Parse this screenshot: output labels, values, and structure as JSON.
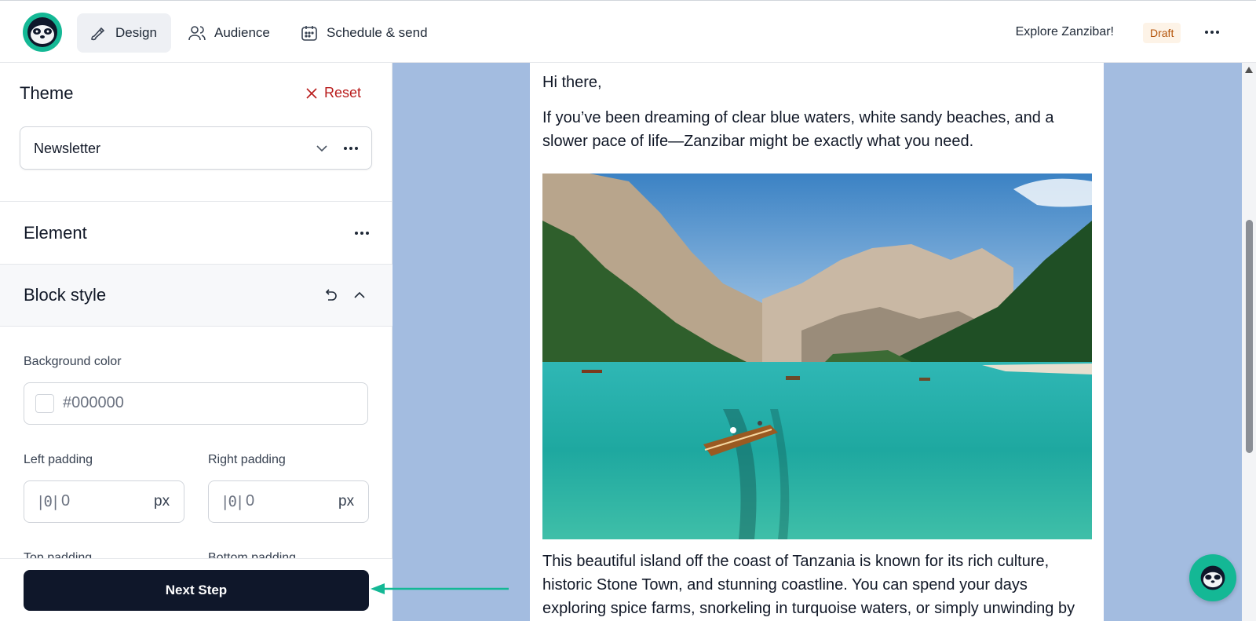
{
  "header": {
    "nav": [
      {
        "label": "Design",
        "icon": "brush-icon",
        "active": true
      },
      {
        "label": "Audience",
        "icon": "users-icon",
        "active": false
      },
      {
        "label": "Schedule & send",
        "icon": "calendar-icon",
        "active": false
      }
    ],
    "campaign_name": "Explore Zanzibar!",
    "status_badge": "Draft"
  },
  "theme": {
    "title": "Theme",
    "reset_label": "Reset",
    "selected": "Newsletter"
  },
  "element": {
    "title": "Element"
  },
  "block_style": {
    "title": "Block style",
    "background_color_label": "Background color",
    "background_color_value": "#000000",
    "left_padding_label": "Left padding",
    "left_padding_value": "0",
    "right_padding_label": "Right padding",
    "right_padding_value": "0",
    "unit": "px",
    "top_padding_label": "Top padding",
    "bottom_padding_label": "Bottom padding"
  },
  "footer": {
    "next_step_label": "Next Step"
  },
  "email": {
    "greeting": "Hi there,",
    "intro": "If you’ve been dreaming of clear blue waters, white sandy beaches, and a slower pace of life—Zanzibar might be exactly what you need.",
    "body": "This beautiful island off the coast of Tanzania is known for its rich culture, historic Stone Town, and stunning coastline. You can spend your days exploring spice farms, snorkeling in turquoise waters, or simply unwinding by"
  },
  "colors": {
    "accent": "#14b895",
    "canvas_bg": "#a3bce0",
    "reset": "#b91c1c",
    "primary_button": "#0f172a"
  }
}
